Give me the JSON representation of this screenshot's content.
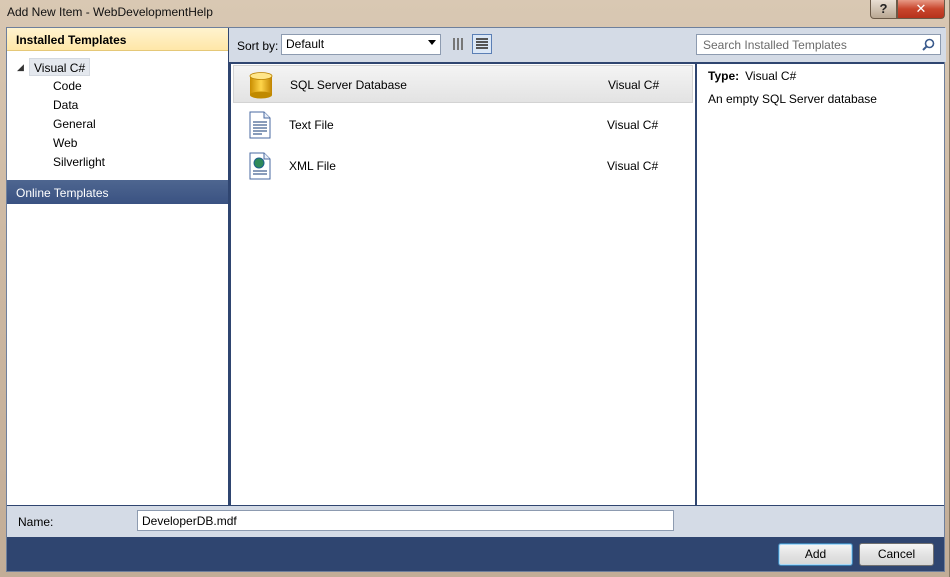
{
  "window": {
    "title": "Add New Item - WebDevelopmentHelp",
    "help_label": "?",
    "close_label": "✕"
  },
  "left": {
    "installed_header": "Installed Templates",
    "tree_root": "Visual C#",
    "tree_children": [
      "Code",
      "Data",
      "General",
      "Web",
      "Silverlight"
    ],
    "online_header": "Online Templates"
  },
  "toolbar": {
    "sort_label": "Sort by:",
    "sort_value": "Default",
    "search_placeholder": "Search Installed Templates"
  },
  "templates": [
    {
      "name": "SQL Server Database",
      "language": "Visual C#",
      "icon": "database-icon",
      "selected": true
    },
    {
      "name": "Text File",
      "language": "Visual C#",
      "icon": "text-file-icon",
      "selected": false
    },
    {
      "name": "XML File",
      "language": "Visual C#",
      "icon": "xml-file-icon",
      "selected": false
    }
  ],
  "details": {
    "type_label": "Type:",
    "type_value": "Visual C#",
    "description": "An empty SQL Server database"
  },
  "name_field": {
    "label": "Name:",
    "value": "DeveloperDB.mdf"
  },
  "buttons": {
    "add": "Add",
    "cancel": "Cancel"
  },
  "colors": {
    "accent": "#3a5282",
    "selected_header": "#ffe7a8",
    "close": "#c8452c"
  }
}
